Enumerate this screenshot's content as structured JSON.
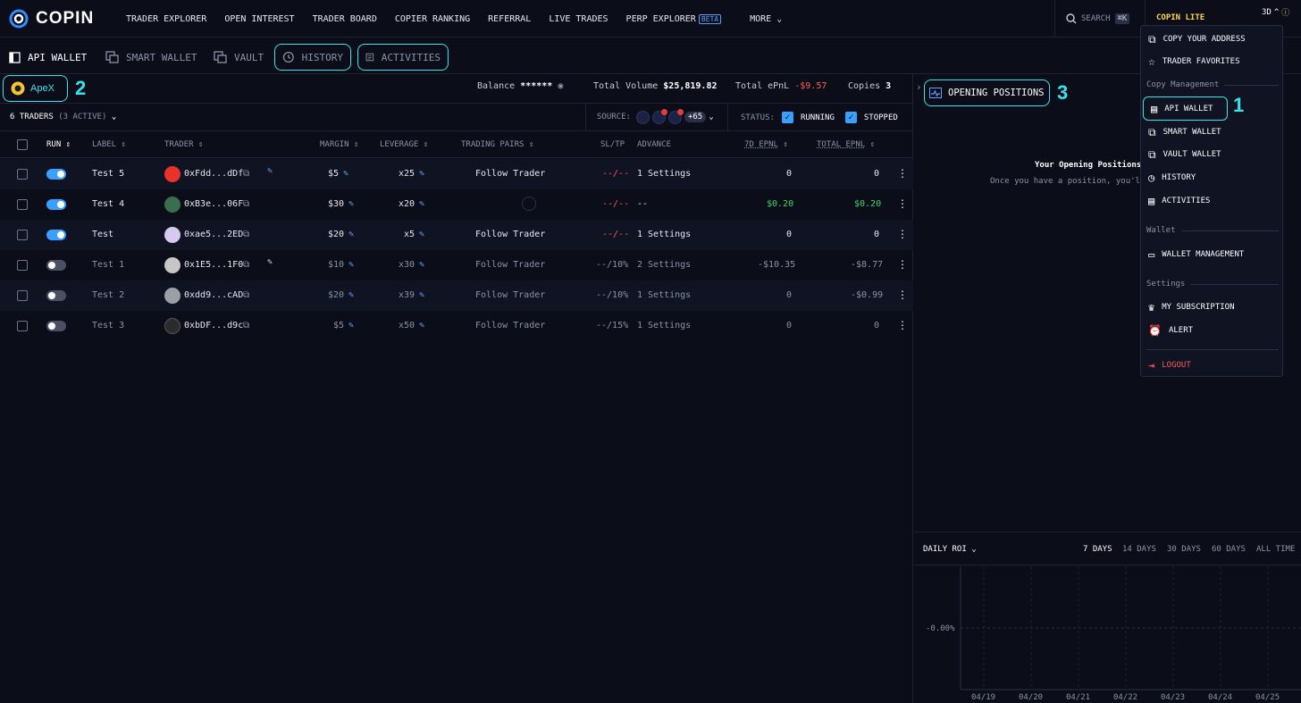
{
  "nav": {
    "brand": "COPIN",
    "items": [
      "TRADER EXPLORER",
      "OPEN INTEREST",
      "TRADER BOARD",
      "COPIER RANKING",
      "REFERRAL",
      "LIVE TRADES",
      "PERP EXPLORER"
    ],
    "beta": "BETA",
    "more": "MORE",
    "search": "SEARCH",
    "search_kbd": "⌘K",
    "lite": "COPIN LITE",
    "account_suffix": "3D"
  },
  "subnav": {
    "tabs": [
      "API WALLET",
      "SMART WALLET",
      "VAULT",
      "HISTORY",
      "ACTIVITIES"
    ]
  },
  "wallet": {
    "protocol": "ApeX",
    "balance_label": "Balance",
    "balance_value": "******",
    "volume_label": "Total Volume",
    "volume_value": "$25,819.82",
    "epnl_label": "Total ePnL",
    "epnl_value": "-$9.57",
    "copies_label": "Copies",
    "copies_value": "3"
  },
  "annotations": {
    "n1": "1",
    "n2": "2",
    "n3": "3"
  },
  "filters": {
    "traders_count": "6 TRADERS",
    "active_count": "(3 ACTIVE)",
    "source_label": "SOURCE:",
    "source_more": "+65",
    "status_label": "STATUS:",
    "running": "RUNNING",
    "stopped": "STOPPED"
  },
  "table": {
    "headers": {
      "run": "RUN",
      "label": "LABEL",
      "trader": "TRADER",
      "margin": "MARGIN",
      "leverage": "LEVERAGE",
      "pairs": "TRADING PAIRS",
      "sltp": "SL/TP",
      "advance": "ADVANCE",
      "epnl7d": "7D EPNL",
      "total_epnl": "TOTAL EPNL"
    },
    "rows": [
      {
        "label": "Test 5",
        "trader": "0xFdd...dDf",
        "margin": "$5",
        "leverage": "x25",
        "pairs": "Follow Trader",
        "sltp": "--/--",
        "advance": "1 Settings",
        "epnl7d": "0",
        "total": "0"
      },
      {
        "label": "Test 4",
        "trader": "0xB3e...06F",
        "margin": "$30",
        "leverage": "x20",
        "pairs": "",
        "sltp": "--/--",
        "advance": "--",
        "epnl7d": "$0.20",
        "total": "$0.20"
      },
      {
        "label": "Test",
        "trader": "0xae5...2ED",
        "margin": "$20",
        "leverage": "x5",
        "pairs": "Follow Trader",
        "sltp": "--/--",
        "advance": "1 Settings",
        "epnl7d": "0",
        "total": "0"
      },
      {
        "label": "Test 1",
        "trader": "0x1E5...1F0",
        "margin": "$10",
        "leverage": "x30",
        "pairs": "Follow Trader",
        "sltp": "--/10%",
        "advance": "2 Settings",
        "epnl7d": "-$10.35",
        "total": "-$8.77"
      },
      {
        "label": "Test 2",
        "trader": "0xdd9...cAD",
        "margin": "$20",
        "leverage": "x39",
        "pairs": "Follow Trader",
        "sltp": "--/10%",
        "advance": "1 Settings",
        "epnl7d": "0",
        "total": "-$0.99"
      },
      {
        "label": "Test 3",
        "trader": "0xbDF...d9c",
        "margin": "$5",
        "leverage": "x50",
        "pairs": "Follow Trader",
        "sltp": "--/15%",
        "advance": "1 Settings",
        "epnl7d": "0",
        "total": "0"
      }
    ]
  },
  "positions": {
    "button": "OPENING POSITIONS",
    "empty_title": "Your Opening Positions",
    "empty_sub": "Once you have a position, you'll"
  },
  "roi": {
    "label": "DAILY ROI",
    "ranges": [
      "7 DAYS",
      "14 DAYS",
      "30 DAYS",
      "60 DAYS",
      "ALL TIME"
    ],
    "y_tick": "-0.00%",
    "x_ticks": [
      "04/19",
      "04/20",
      "04/21",
      "04/22",
      "04/23",
      "04/24",
      "04/25"
    ]
  },
  "menu": {
    "copy_address": "COPY YOUR ADDRESS",
    "favorites": "TRADER FAVORITES",
    "sec_copy": "Copy Management",
    "api_wallet": "API WALLET",
    "smart_wallet": "SMART WALLET",
    "vault_wallet": "VAULT WALLET",
    "history": "HISTORY",
    "activities": "ACTIVITIES",
    "sec_wallet": "Wallet",
    "wallet_mgmt": "WALLET MANAGEMENT",
    "sec_settings": "Settings",
    "subscription": "MY SUBSCRIPTION",
    "alert": "ALERT",
    "logout": "LOGOUT"
  },
  "colors": {
    "accent": "#34e3f0",
    "blue": "#3aa0ff",
    "neg": "#ff5a5a",
    "pos": "#3ad56a",
    "lite": "#ffd54a"
  }
}
